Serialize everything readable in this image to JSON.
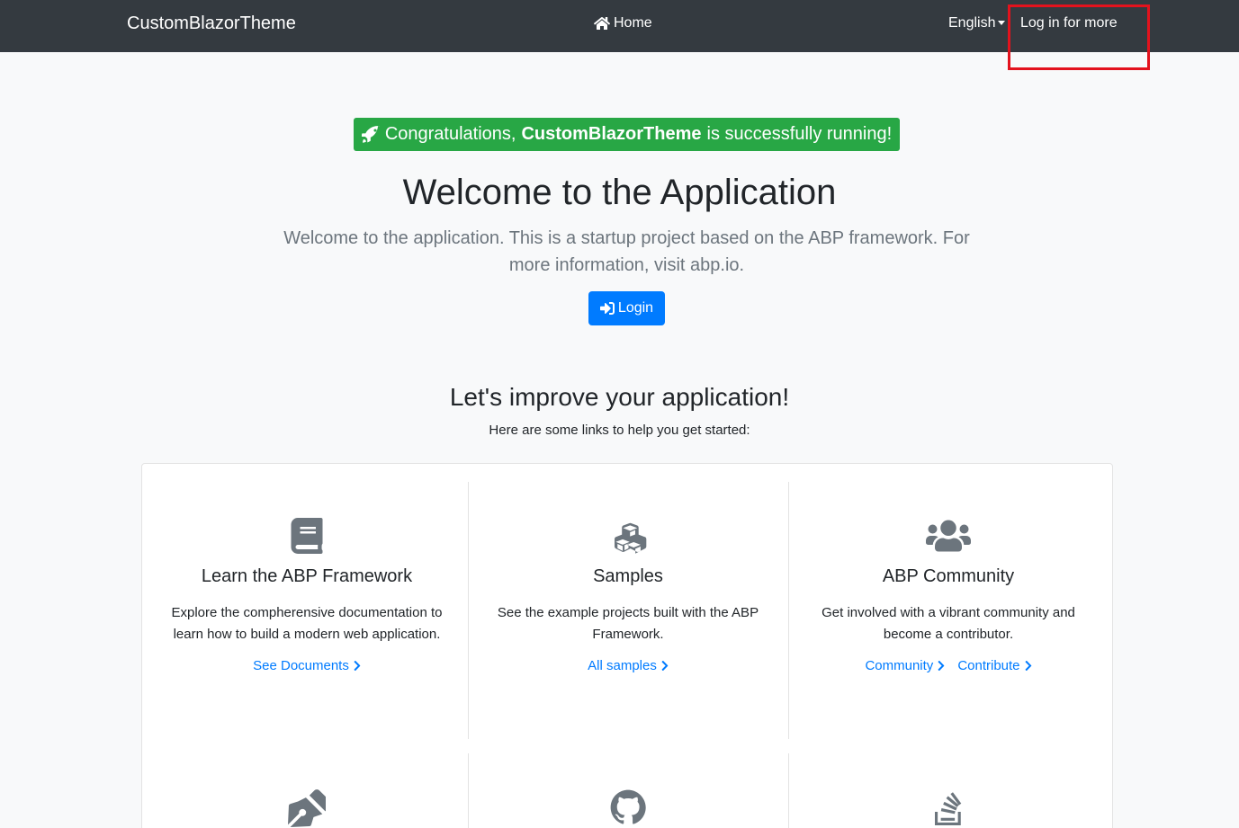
{
  "navbar": {
    "brand": "CustomBlazorTheme",
    "home_label": "Home",
    "language_label": "English",
    "login_label": "Log in for more"
  },
  "hero": {
    "alert_prefix": "Congratulations,",
    "alert_app": "CustomBlazorTheme",
    "alert_suffix": "is successfully running!",
    "title": "Welcome to the Application",
    "lead": "Welcome to the application. This is a startup project based on the ABP framework. For more information, visit abp.io.",
    "login_button": "Login"
  },
  "section": {
    "title": "Let's improve your application!",
    "subtitle": "Here are some links to help you get started:"
  },
  "cards": [
    {
      "icon": "book-icon",
      "title": "Learn the ABP Framework",
      "description": "Explore the compherensive documentation to learn how to build a modern web application.",
      "links": [
        "See Documents"
      ]
    },
    {
      "icon": "cubes-icon",
      "title": "Samples",
      "description": "See the example projects built with the ABP Framework.",
      "links": [
        "All samples"
      ]
    },
    {
      "icon": "users-icon",
      "title": "ABP Community",
      "description": "Get involved with a vibrant community and become a contributor.",
      "links": [
        "Community",
        "Contribute"
      ]
    }
  ],
  "second_row_icons": [
    "pen-nib-icon",
    "github-icon",
    "stack-overflow-icon"
  ],
  "colors": {
    "navbar": "#343a40",
    "success": "#28a745",
    "primary": "#007bff",
    "highlight": "#e3121d",
    "icon": "#6c757d"
  }
}
